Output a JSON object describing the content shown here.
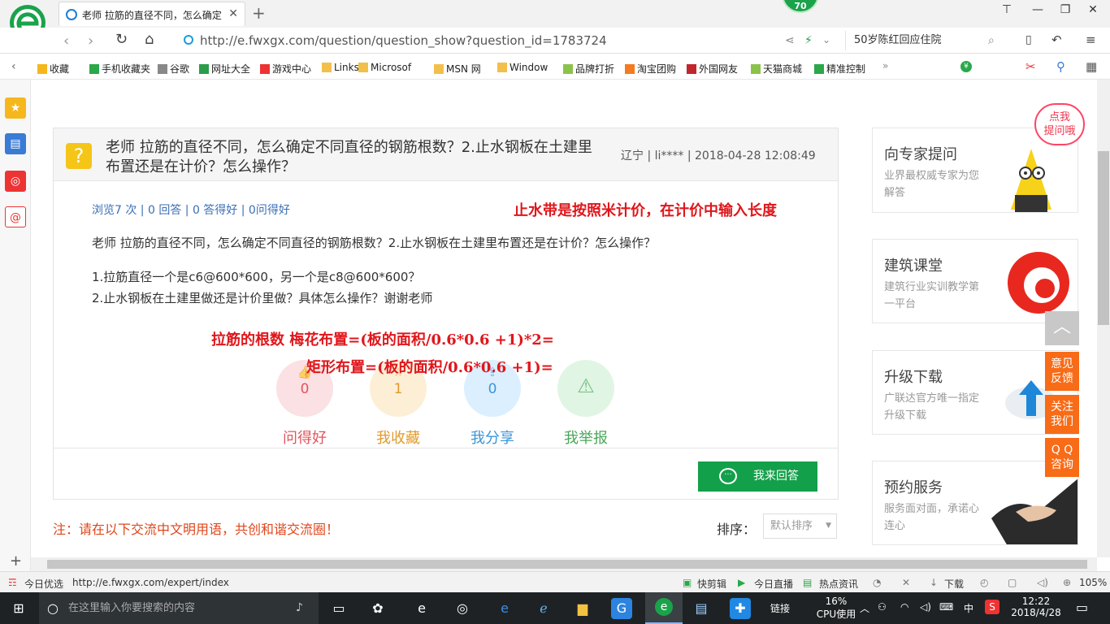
{
  "browser": {
    "tab_title": "老师 拉筋的直径不同，怎么确定",
    "badge": "70",
    "address": "http://e.fwxgx.com/question/question_show?question_id=1783724",
    "search_text": "50岁陈红回应住院"
  },
  "favorites": [
    "收藏",
    "手机收藏夹",
    "谷歌",
    "网址大全",
    "游戏中心",
    "Links",
    "Microsof",
    "MSN 网",
    "Window",
    "品牌打折",
    "淘宝团购",
    "外国网友",
    "天猫商城",
    "精准控制"
  ],
  "question": {
    "title": "老师 拉筋的直径不同，怎么确定不同直径的钢筋根数？2.止水钢板在土建里布置还是在计价？怎么操作？",
    "meta": "辽宁 | li**** | 2018-04-28 12:08:49",
    "stats": "浏览7 次 | 0 回答 | 0 答得好 | 0问得好",
    "body1": "老师  拉筋的直径不同，怎么确定不同直径的钢筋根数？2.止水钢板在土建里布置还是在计价？怎么操作？",
    "body2": "1.拉筋直径一个是c6@600*600，另一个是c8@600*600？",
    "body3": "2.止水钢板在土建里做还是计价里做？具体怎么操作？谢谢老师"
  },
  "annotations": {
    "red1": "止水带是按照米计价，在计价中输入长度",
    "red2": "拉筋的根数 梅花布置=(板的面积/0.6*0.6 +1)*2=",
    "red3": "矩形布置=(板的面积/0.6*0.6 +1)="
  },
  "actions": [
    {
      "count": "0",
      "label": "问得好",
      "color": "#e0555d",
      "bg": "#fbe1e3"
    },
    {
      "count": "1",
      "label": "我收藏",
      "color": "#e09a2c",
      "bg": "#fcefd6"
    },
    {
      "count": "0",
      "label": "我分享",
      "color": "#3b95d8",
      "bg": "#dcefff"
    },
    {
      "count": "",
      "label": "我举报",
      "color": "#4aa65a",
      "bg": "#e1f5e4"
    }
  ],
  "answer_button": "我来回答",
  "notice": "注：请在以下交流中文明用语，共创和谐交流圈！",
  "sort": {
    "label": "排序：",
    "selected": "默认排序"
  },
  "sidebar_cards": [
    {
      "title": "向专家提问",
      "sub": "业界最权威专家为您解答"
    },
    {
      "title": "建筑课堂",
      "sub": "建筑行业实训教学第一平台"
    },
    {
      "title": "升级下载",
      "sub": "广联达官方唯一指定升级下载"
    },
    {
      "title": "预约服务",
      "sub": "服务面对面，承诺心连心"
    }
  ],
  "bubble": "点我\n提问哦",
  "float_buttons": [
    "意见\n反馈",
    "关注\n我们",
    "Q Q\n咨询"
  ],
  "statusbar": {
    "today": "今日优选",
    "url": "http://e.fwxgx.com/expert/index",
    "items": [
      "快剪辑",
      "今日直播",
      "热点资讯",
      "下载"
    ],
    "zoom": "105%"
  },
  "taskbar": {
    "search_placeholder": "在这里输入你要搜索的内容",
    "link": "链接",
    "cpu": "16%",
    "cpu_label": "CPU使用",
    "ime": "中",
    "time": "12:22",
    "date": "2018/4/28"
  }
}
